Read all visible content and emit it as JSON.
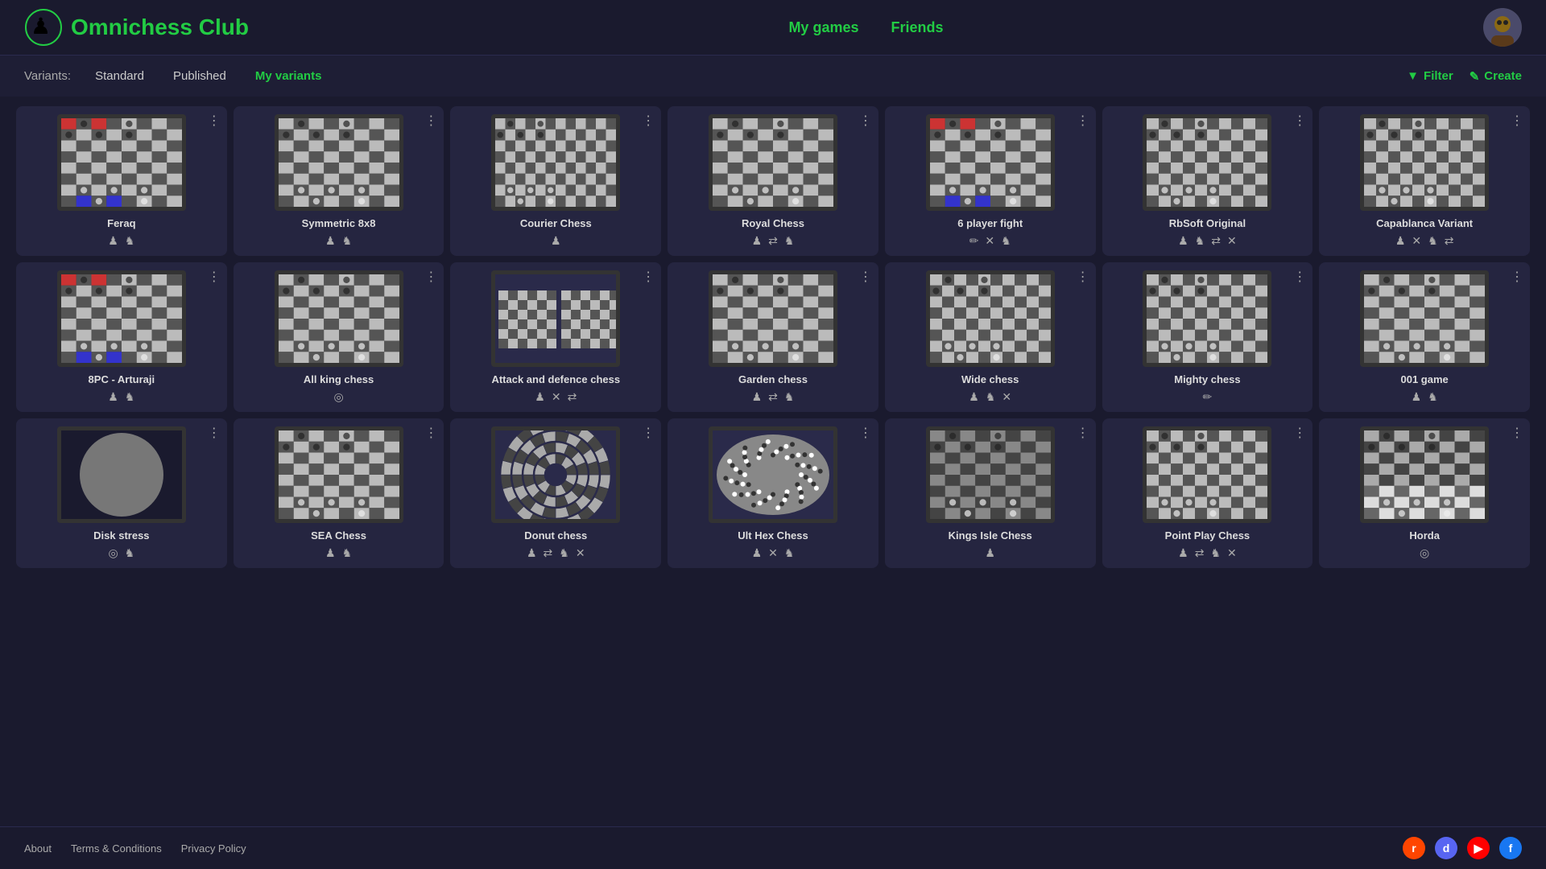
{
  "header": {
    "logo_text": "Omnichess Club",
    "nav": [
      {
        "label": "My games",
        "id": "my-games"
      },
      {
        "label": "Friends",
        "id": "friends"
      }
    ]
  },
  "tabs": {
    "label": "Variants:",
    "items": [
      {
        "label": "Standard",
        "active": false
      },
      {
        "label": "Published",
        "active": false
      },
      {
        "label": "My variants",
        "active": true,
        "green": true
      }
    ],
    "filter_label": "Filter",
    "create_label": "Create"
  },
  "variants": [
    {
      "name": "Feraq",
      "board_type": "8x8_color",
      "icons": [
        "♟",
        "♞"
      ]
    },
    {
      "name": "Symmetric 8x8",
      "board_type": "8x8",
      "icons": [
        "♟",
        "♞"
      ]
    },
    {
      "name": "Courier Chess",
      "board_type": "12x8",
      "icons": [
        "♟"
      ]
    },
    {
      "name": "Royal Chess",
      "board_type": "8x8",
      "icons": [
        "♟",
        "⇄",
        "♞"
      ]
    },
    {
      "name": "6 player fight",
      "board_type": "8x8_multi",
      "icons": [
        "✏",
        "✕",
        "♞"
      ]
    },
    {
      "name": "RbSoft Original",
      "board_type": "10x8",
      "icons": [
        "♟",
        "♞",
        "⇄",
        "✕"
      ]
    },
    {
      "name": "Capablanca Variant",
      "board_type": "10x8",
      "icons": [
        "♟",
        "✕",
        "♞",
        "⇄"
      ]
    },
    {
      "name": "8PC - Arturaji",
      "board_type": "8x8_color",
      "icons": [
        "♟",
        "♞"
      ]
    },
    {
      "name": "All king chess",
      "board_type": "8x8",
      "icons": [
        "◎"
      ]
    },
    {
      "name": "Attack and defence chess",
      "board_type": "split",
      "icons": [
        "♟",
        "✕",
        "⇄"
      ]
    },
    {
      "name": "Garden chess",
      "board_type": "8x8",
      "icons": [
        "♟",
        "⇄",
        "♞"
      ]
    },
    {
      "name": "Wide chess",
      "board_type": "10x8",
      "icons": [
        "♟",
        "♞",
        "✕"
      ]
    },
    {
      "name": "Mighty chess",
      "board_type": "10x8",
      "icons": [
        "✏"
      ]
    },
    {
      "name": "001 game",
      "board_type": "8x8",
      "icons": [
        "♟",
        "♞"
      ]
    },
    {
      "name": "Disk stress",
      "board_type": "circular_dark",
      "icons": [
        "◎",
        "♞"
      ]
    },
    {
      "name": "SEA Chess",
      "board_type": "8x8",
      "icons": [
        "♟",
        "♞"
      ]
    },
    {
      "name": "Donut chess",
      "board_type": "donut",
      "icons": [
        "♟",
        "⇄",
        "♞",
        "✕"
      ]
    },
    {
      "name": "Ult Hex Chess",
      "board_type": "hex",
      "icons": [
        "♟",
        "✕",
        "♞"
      ]
    },
    {
      "name": "Kings Isle Chess",
      "board_type": "8x8_gray",
      "icons": [
        "♟"
      ]
    },
    {
      "name": "Point Play Chess",
      "board_type": "10x8",
      "icons": [
        "♟",
        "⇄",
        "♞",
        "✕"
      ]
    },
    {
      "name": "Horda",
      "board_type": "8x8_asym",
      "icons": [
        "◎"
      ]
    }
  ],
  "footer": {
    "links": [
      "About",
      "Terms & Conditions",
      "Privacy Policy"
    ],
    "social": [
      "reddit",
      "discord",
      "youtube",
      "facebook"
    ]
  }
}
